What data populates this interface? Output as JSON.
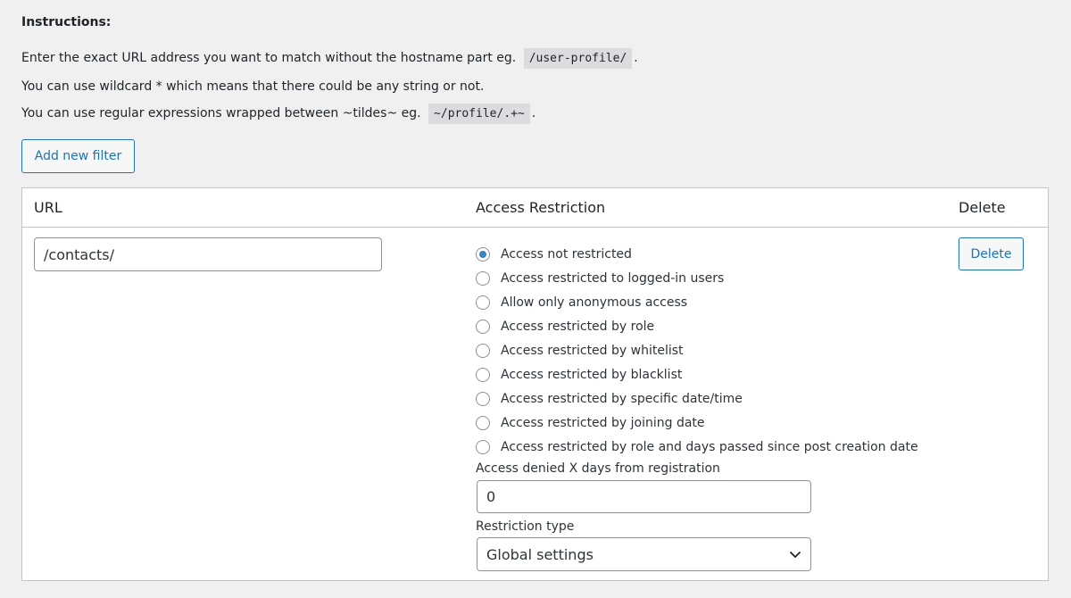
{
  "instructions": {
    "title": "Instructions:",
    "line1_text": "Enter the exact URL address you want to match without the hostname part eg.",
    "line1_code": "/user-profile/",
    "line1_end": ".",
    "line2_text": "You can use wildcard * which means that there could be any string or not.",
    "line3_text": "You can use regular expressions wrapped between ~tildes~ eg.",
    "line3_code": "~/profile/.+~",
    "line3_end": "."
  },
  "toolbar": {
    "add_filter_label": "Add new filter"
  },
  "table": {
    "headers": {
      "url": "URL",
      "access": "Access Restriction",
      "delete": "Delete"
    },
    "row": {
      "url_value": "/contacts/",
      "delete_label": "Delete",
      "restriction_options": [
        {
          "label": "Access not restricted",
          "checked": true
        },
        {
          "label": "Access restricted to logged-in users",
          "checked": false
        },
        {
          "label": "Allow only anonymous access",
          "checked": false
        },
        {
          "label": "Access restricted by role",
          "checked": false
        },
        {
          "label": "Access restricted by whitelist",
          "checked": false
        },
        {
          "label": "Access restricted by blacklist",
          "checked": false
        },
        {
          "label": "Access restricted by specific date/time",
          "checked": false
        },
        {
          "label": "Access restricted by joining date",
          "checked": false
        },
        {
          "label": "Access restricted by role and days passed since post creation date",
          "checked": false
        }
      ],
      "days_label": "Access denied X days from registration",
      "days_value": "0",
      "restriction_type_label": "Restriction type",
      "restriction_type_value": "Global settings"
    }
  },
  "colors": {
    "accent": "#2271b1",
    "radio_checked": "#3582c4",
    "background": "#f0f0f1"
  }
}
